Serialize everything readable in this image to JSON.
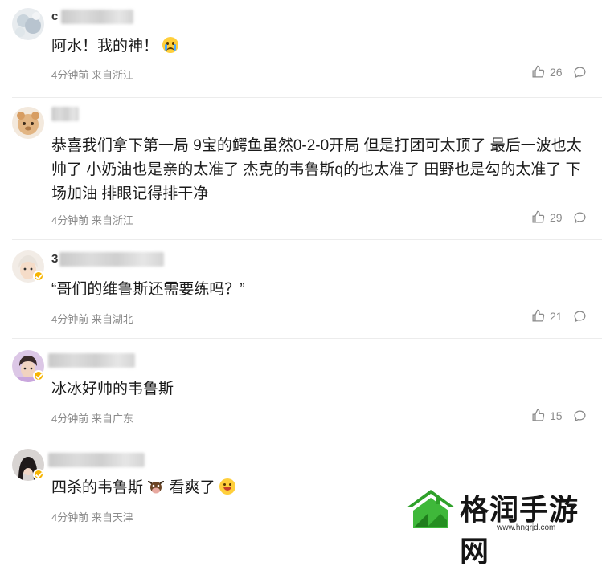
{
  "colors": {
    "accent_badge": "#f6b400",
    "meta_gray": "#8a8a8a",
    "text": "#1a1a1a",
    "watermark_green": "#2fa12a"
  },
  "comments": [
    {
      "name_lead": "c",
      "text": "阿水！我的神！",
      "emoji": "crying-face",
      "time": "4分钟前",
      "location": "来自浙江",
      "likes": "26",
      "verified": false
    },
    {
      "name_lead": "",
      "text": "恭喜我们拿下第一局 9宝的鳄鱼虽然0-2-0开局 但是打团可太顶了 最后一波也太帅了 小奶油也是亲的太准了 杰克的韦鲁斯q的也太准了 田野也是勾的太准了 下场加油 排眼记得排干净",
      "time": "4分钟前",
      "location": "来自浙江",
      "likes": "29",
      "verified": false
    },
    {
      "name_lead": "3",
      "text": "“哥们的维鲁斯还需要练吗？”",
      "time": "4分钟前",
      "location": "来自湖北",
      "likes": "21",
      "verified": true
    },
    {
      "name_lead": "",
      "text": "冰冰好帅的韦鲁斯",
      "time": "4分钟前",
      "location": "来自广东",
      "likes": "15",
      "verified": true
    },
    {
      "name_lead": "",
      "text_part1": "四杀的韦鲁斯",
      "text_part2": "看爽了",
      "time": "4分钟前",
      "location": "来自天津",
      "verified": true
    }
  ],
  "icons": {
    "like": "thumbs-up-icon",
    "reply": "comment-bubble-icon",
    "cow": "cow-face-icon"
  },
  "watermark": {
    "brand": "格润手游网",
    "url": "www.hngrjd.com"
  }
}
